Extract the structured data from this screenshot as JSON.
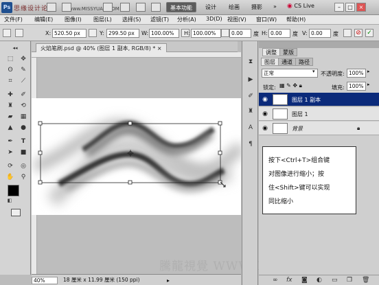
{
  "app": {
    "logo": "Ps",
    "watermark_top": "思缘设计论坛",
    "watermark_top_url": "www.MISSYUAN.COM",
    "workspace_buttons": [
      "基本功能",
      "设计",
      "绘画",
      "摄影"
    ],
    "more": "»",
    "cs_live": "CS Live",
    "window_controls": [
      "–",
      "□",
      "×"
    ]
  },
  "menu": [
    "文件(F)",
    "编辑(E)",
    "图像(I)",
    "图层(L)",
    "选择(S)",
    "滤镜(T)",
    "分析(A)",
    "3D(D)",
    "视图(V)",
    "窗口(W)",
    "帮助(H)"
  ],
  "options": {
    "x_label": "X:",
    "x_value": "520.50 px",
    "y_label": "Y:",
    "y_value": "299.50 px",
    "w_label": "W:",
    "w_value": "100.00%",
    "h_label": "H:",
    "h_value": "100.00%",
    "angle_value": "0.00",
    "angle_unit": "度",
    "hskew_label": "H:",
    "hskew_value": "0.00",
    "hskew_unit": "度",
    "vskew_label": "V:",
    "vskew_value": "0.00",
    "vskew_unit": "度"
  },
  "document": {
    "tab_title": "火焰笔刷.psd @ 40% (图层 1 副本, RGB/8) *",
    "close": "×"
  },
  "status": {
    "zoom": "40%",
    "info": "18 厘米 x 11.99 厘米 (150 ppi)"
  },
  "panels": {
    "tabs_top": [
      "调整",
      "蒙版"
    ],
    "tabs_layers": [
      "图层",
      "通道",
      "路径"
    ],
    "blend_mode": "正常",
    "opacity_label": "不透明度:",
    "opacity_value": "100%",
    "lock_label": "锁定:",
    "fill_label": "填充:",
    "fill_value": "100%",
    "layers": [
      {
        "name": "图层 1 副本",
        "selected": true
      },
      {
        "name": "图层 1",
        "selected": false
      },
      {
        "name": "背景",
        "selected": false
      }
    ],
    "footer_icons": [
      "link-icon",
      "fx-icon",
      "mask-icon",
      "adjustment-icon",
      "folder-icon",
      "new-layer-icon",
      "trash-icon"
    ]
  },
  "callout": {
    "lines": [
      "按下<Ctrl+T>组合键",
      "对图像进行缩小；按",
      "住<Shift>键可以实现",
      "同比缩小"
    ]
  },
  "watermark_bottom": "騰龍視覺 WWW.TLVI.NET"
}
